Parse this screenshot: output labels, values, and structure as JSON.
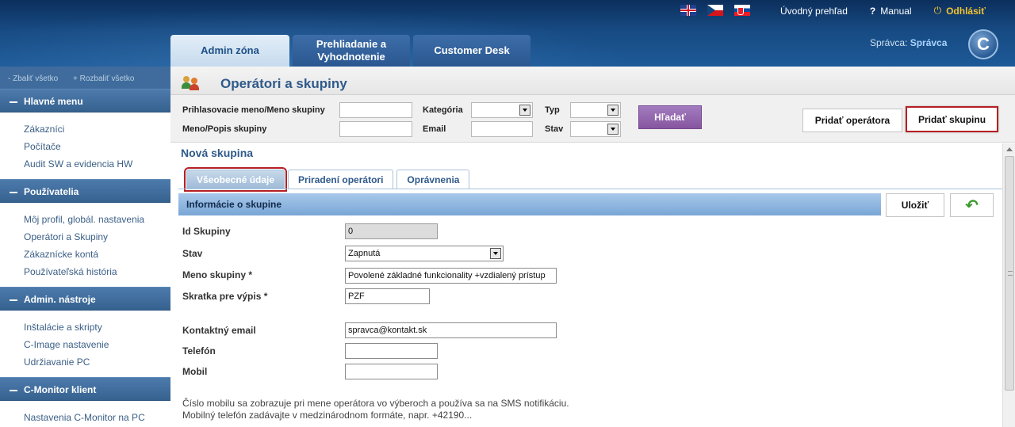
{
  "header": {
    "flags": [
      "uk-flag-icon",
      "cz-flag-icon",
      "sk-flag-icon"
    ],
    "links": {
      "overview": "Úvodný prehľad",
      "manual": "Manual",
      "logout": "Odhlásiť"
    },
    "help_icon_glyph": "?",
    "power_icon_glyph": "⏻",
    "tabs": [
      {
        "label_line1": "Admin zóna",
        "label_line2": ""
      },
      {
        "label_line1": "Prehliadanie a",
        "label_line2": "Vyhodnotenie"
      },
      {
        "label_line1": "Customer Desk",
        "label_line2": ""
      }
    ],
    "admin_prefix": "Správca: ",
    "admin_name": "Správca",
    "logo_letter": "C"
  },
  "sidebar": {
    "collapse_all": "- Zbaliť všetko",
    "expand_all": "+ Rozbaliť všetko",
    "sections": [
      {
        "title": "Hlavné menu",
        "items": [
          "Zákazníci",
          "Počítače",
          "Audit SW a evidencia HW"
        ]
      },
      {
        "title": "Používatelia",
        "items": [
          "Môj profil, globál. nastavenia",
          "Operátori a Skupiny",
          "Zákaznícke kontá",
          "Používateľská história"
        ]
      },
      {
        "title": "Admin. nástroje",
        "items": [
          "Inštalácie a skripty",
          "C-Image nastavenie",
          "Udržiavanie PC"
        ]
      },
      {
        "title": "C-Monitor klient",
        "items": [
          "Nastavenia C-Monitor na PC"
        ]
      }
    ]
  },
  "page": {
    "title": "Operátori a skupiny"
  },
  "search": {
    "login_label": "Prihlasovacie meno/Meno skupiny",
    "name_label": "Meno/Popis skupiny",
    "category_label": "Kategória",
    "email_label": "Email",
    "type_label": "Typ",
    "state_label": "Stav",
    "search_button": "Hľadať",
    "add_operator_button": "Pridať operátora",
    "add_group_button": "Pridať skupinu"
  },
  "form": {
    "title": "Nová skupina",
    "tabs": [
      "Všeobecné údaje",
      "Priradení operátori",
      "Oprávnenia"
    ],
    "section_title": "Informácie o skupine",
    "save_button": "Uložiť",
    "back_icon_glyph": "↶",
    "fields": {
      "id_label": "Id Skupiny",
      "id_value": "0",
      "state_label": "Stav",
      "state_value": "Zapnutá",
      "name_label": "Meno skupiny *",
      "name_value": "Povolené základné funkcionality +vzdialený prístup",
      "abbr_label": "Skratka pre výpis *",
      "abbr_value": "PZF",
      "email_label": "Kontaktný email",
      "email_value": "spravca@kontakt.sk",
      "phone_label": "Telefón",
      "phone_value": "",
      "mobile_label": "Mobil",
      "mobile_value": ""
    },
    "note_line1": "Číslo mobilu sa zobrazuje pri mene operátora vo výberoch a používa sa na SMS notifikáciu.",
    "note_line2": "Mobilný telefón zadávajte v medzinárodnom formáte, napr. +42190..."
  },
  "colors": {
    "header_dark": "#0c2f5c",
    "sidebar_bg": "#3f6c9c",
    "title_blue": "#2f5a8a",
    "search_button": "#86569f",
    "highlight_red": "#b61f24",
    "logout_yellow": "#f2c230"
  }
}
